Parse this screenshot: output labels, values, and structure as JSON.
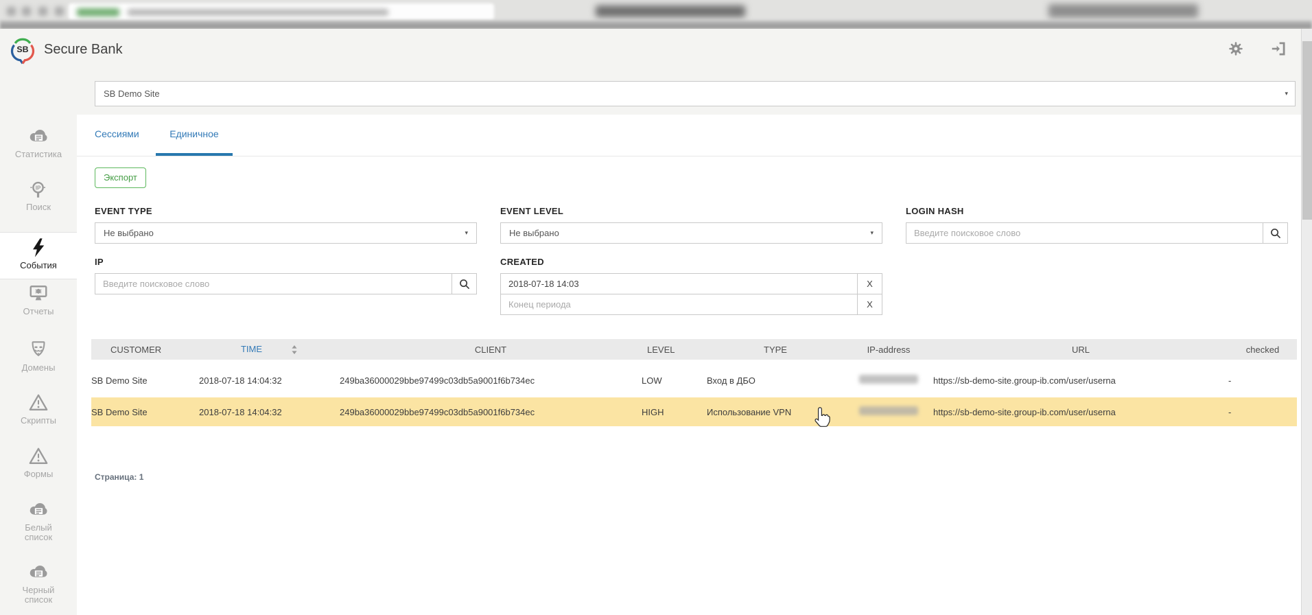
{
  "header": {
    "brand": "Secure Bank",
    "logo_text": "SB"
  },
  "site_selector": {
    "value": "SB Demo Site"
  },
  "sidebar": {
    "items": [
      {
        "label": "Статистика",
        "icon": "cloud-list-icon",
        "active": false
      },
      {
        "label": "Поиск",
        "icon": "ip-search-icon",
        "active": false
      },
      {
        "label": "События",
        "icon": "lightning-icon",
        "active": true
      },
      {
        "label": "Отчеты",
        "icon": "monitor-bug-icon",
        "active": false
      },
      {
        "label": "Домены",
        "icon": "anonymous-mask-icon",
        "active": false
      },
      {
        "label": "Скрипты",
        "icon": "warning-triangle-icon",
        "active": false
      },
      {
        "label": "Формы",
        "icon": "warning-triangle-icon",
        "active": false
      },
      {
        "label": "Белый список",
        "icon": "cloud-list-icon",
        "active": false
      },
      {
        "label": "Черный список",
        "icon": "cloud-list-icon",
        "active": false
      }
    ]
  },
  "tabs": [
    {
      "label": "Сессиями",
      "active": false
    },
    {
      "label": "Единичное",
      "active": true
    }
  ],
  "toolbar": {
    "export_label": "Экспорт"
  },
  "filters": {
    "event_type": {
      "label": "EVENT TYPE",
      "value": "Не выбрано"
    },
    "event_level": {
      "label": "EVENT LEVEL",
      "value": "Не выбрано"
    },
    "login_hash": {
      "label": "LOGIN HASH",
      "placeholder": "Введите поисковое слово"
    },
    "ip": {
      "label": "IP",
      "placeholder": "Введите поисковое слово"
    },
    "created": {
      "label": "CREATED",
      "start_value": "2018-07-18 14:03",
      "end_placeholder": "Конец периода",
      "clear_label": "X"
    }
  },
  "table": {
    "headers": {
      "customer": "CUSTOMER",
      "time": "TIME",
      "client": "CLIENT",
      "level": "LEVEL",
      "type": "TYPE",
      "ip": "IP-address",
      "url": "URL",
      "checked": "checked"
    },
    "rows": [
      {
        "customer": "SB Demo Site",
        "time": "2018-07-18 14:04:32",
        "client": "249ba36000029bbe97499c03db5a9001f6b734ec",
        "level": "LOW",
        "type": "Вход в ДБО",
        "url": "https://sb-demo-site.group-ib.com/user/userna",
        "checked": "-"
      },
      {
        "customer": "SB Demo Site",
        "time": "2018-07-18 14:04:32",
        "client": "249ba36000029bbe97499c03db5a9001f6b734ec",
        "level": "HIGH",
        "type": "Использование VPN",
        "url": "https://sb-demo-site.group-ib.com/user/userna",
        "checked": "-"
      }
    ]
  },
  "pagination": {
    "label": "Страница: 1"
  },
  "colors": {
    "accent_blue": "#337ab7",
    "tab_underline": "#2878ae",
    "export_green": "#5cb85c",
    "row_highlight": "#fbe4a3",
    "page_background": "#f4f4f2",
    "table_header_bg": "#eaeaea"
  }
}
